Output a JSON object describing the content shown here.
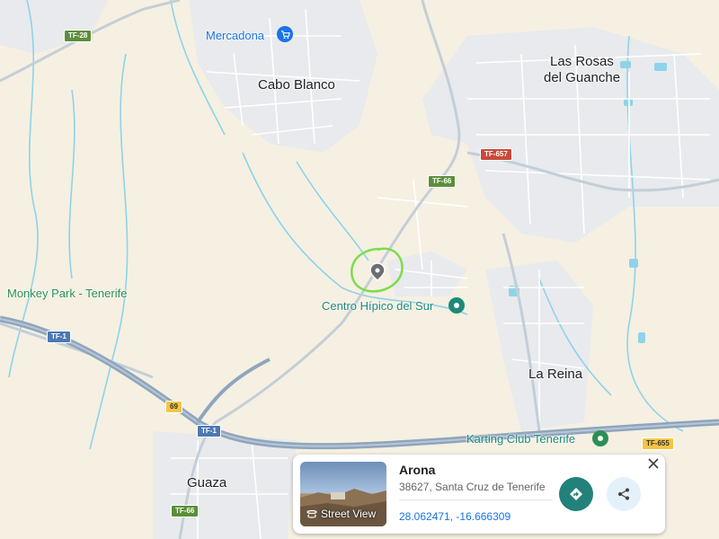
{
  "places": {
    "cabo_blanco": "Cabo Blanco",
    "las_rosas_1": "Las Rosas",
    "las_rosas_2": "del Guanche",
    "la_reina": "La Reina",
    "guaza": "Guaza"
  },
  "pois": {
    "mercadona": "Mercadona",
    "monkey_park": "Monkey Park - Tenerife",
    "centro_hipico": "Centro Hípico del Sur",
    "karting": "Karting Club Tenerife"
  },
  "roads": {
    "tf28": "TF-28",
    "tf657": "TF-657",
    "tf66_north": "TF-66",
    "tf1_west": "TF-1",
    "exit69": "69",
    "tf1_south": "TF-1",
    "tf655": "TF-655",
    "tf66_south": "TF-66"
  },
  "card": {
    "title": "Arona",
    "address": "38627, Santa Cruz de Tenerife",
    "coordinates": "28.062471, -16.666309",
    "street_view_label": "Street View"
  },
  "icons": {
    "pin": "map-pin-icon",
    "directions": "directions-icon",
    "share": "share-icon",
    "close": "close-icon",
    "street_view": "street-view-icon",
    "shopping_cart": "shopping-cart-icon"
  },
  "colors": {
    "land": "#f5f0e2",
    "urban": "#e8eaed",
    "motorway": "#8fa5bd",
    "water": "#8fd3ea",
    "highlight_circle": "#7ddc4a",
    "directions_button": "#22817a"
  }
}
